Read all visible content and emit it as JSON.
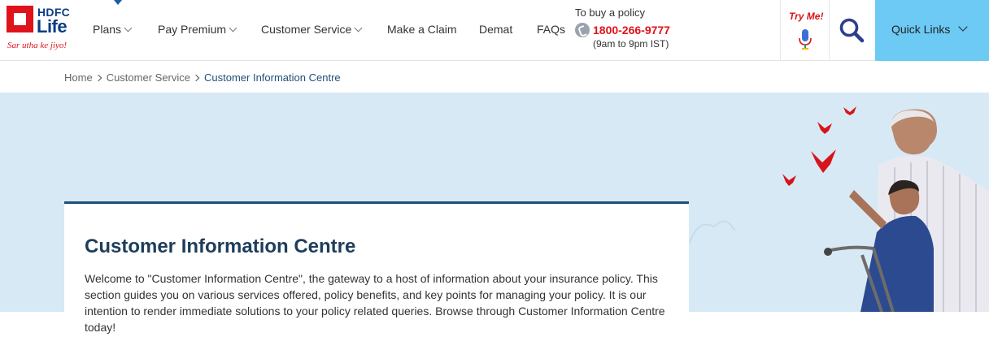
{
  "brand": {
    "name": "HDFC",
    "name_line2": "Life",
    "tagline": "Sar utha ke jiyo!"
  },
  "nav": {
    "items": [
      {
        "label": "Plans",
        "has_dropdown": true
      },
      {
        "label": "Pay Premium",
        "has_dropdown": true
      },
      {
        "label": "Customer Service",
        "has_dropdown": true
      },
      {
        "label": "Make a Claim",
        "has_dropdown": false
      },
      {
        "label": "Demat",
        "has_dropdown": false
      },
      {
        "label": "FAQs",
        "has_dropdown": false
      }
    ]
  },
  "contact": {
    "label": "To buy a policy",
    "phone": "1800-266-9777",
    "hours": "(9am to 9pm IST)",
    "icon": "phone-icon"
  },
  "voice": {
    "label": "Try Me!",
    "icon": "microphone-icon"
  },
  "search": {
    "icon": "search-icon"
  },
  "quick_links": {
    "label": "Quick Links",
    "icon": "chevron-down-icon"
  },
  "breadcrumb": [
    "Home",
    "Customer Service",
    "Customer Information Centre"
  ],
  "content": {
    "title": "Customer Information Centre",
    "body": "Welcome to \"Customer Information Centre\", the gateway to a host of information about your insurance policy. This section guides you on various services offered, policy benefits, and key points for managing your policy. It is our intention to render immediate solutions to your policy related queries. Browse through Customer Information Centre today!"
  },
  "colors": {
    "brand_red": "#e0121b",
    "brand_blue": "#0a3c83",
    "quick_links_bg": "#6ccaf5",
    "banner_bg": "#d8e9f6",
    "title_blue": "#1e3d5c"
  }
}
